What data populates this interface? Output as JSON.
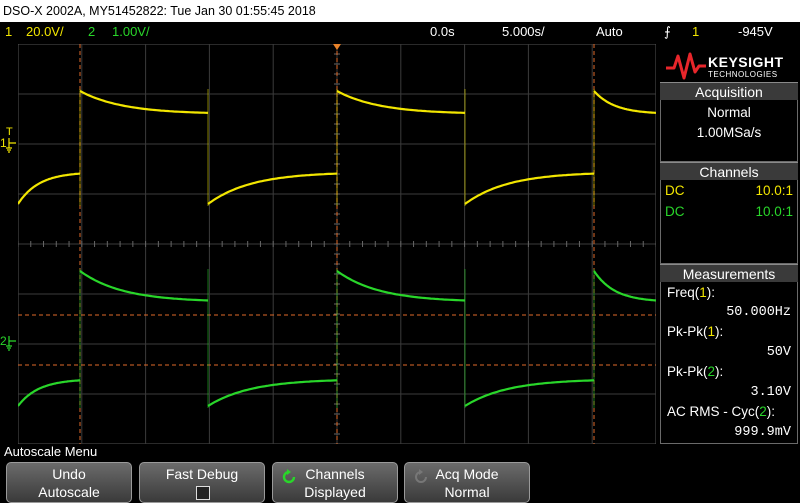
{
  "title_bar": {
    "text": "DSO-X 2002A, MY51452822: Tue Jan 30 01:55:45 2018"
  },
  "status_bar": {
    "ch1_label": "1",
    "ch1_scale": "20.0V/",
    "ch2_label": "2",
    "ch2_scale": "1.00V/",
    "time_delay": "0.0s",
    "time_scale": "5.000s/",
    "trigger_mode": "Auto",
    "trigger_symbol": "⨍",
    "trigger_channel": "1",
    "trigger_level": "-945V"
  },
  "scope": {
    "ch1_color": "#f2e600",
    "ch2_color": "#29d62a",
    "grid_color": "#3b3b3b",
    "cursor_color": "#e06a2a",
    "ch1_marker": "1",
    "ch2_marker": "2",
    "trig_marker": "T"
  },
  "brand": {
    "name": "KEYSIGHT",
    "sub": "TECHNOLOGIES"
  },
  "acquisition": {
    "header": "Acquisition",
    "mode": "Normal",
    "rate": "1.00MSa/s"
  },
  "channels": {
    "header": "Channels",
    "rows": [
      {
        "coupling": "DC",
        "probe": "10.0:1",
        "color": "#f2e600"
      },
      {
        "coupling": "DC",
        "probe": "10.0:1",
        "color": "#29d62a"
      }
    ]
  },
  "measurements": {
    "header": "Measurements",
    "items": [
      {
        "label": "Freq",
        "ch": "1",
        "value": "50.000Hz"
      },
      {
        "label": "Pk-Pk",
        "ch": "1",
        "value": "50V"
      },
      {
        "label": "Pk-Pk",
        "ch": "2",
        "value": "3.10V"
      },
      {
        "label": "AC RMS - Cyc",
        "ch": "2",
        "value": "999.9mV"
      }
    ]
  },
  "menu": {
    "title": "Autoscale Menu"
  },
  "softkeys": [
    {
      "line1": "Undo",
      "line2": "Autoscale"
    },
    {
      "line1": "Fast Debug",
      "line2": ""
    },
    {
      "line1": "Channels",
      "line2": "Displayed"
    },
    {
      "line1": "Acq Mode",
      "line2": "Normal"
    }
  ]
}
